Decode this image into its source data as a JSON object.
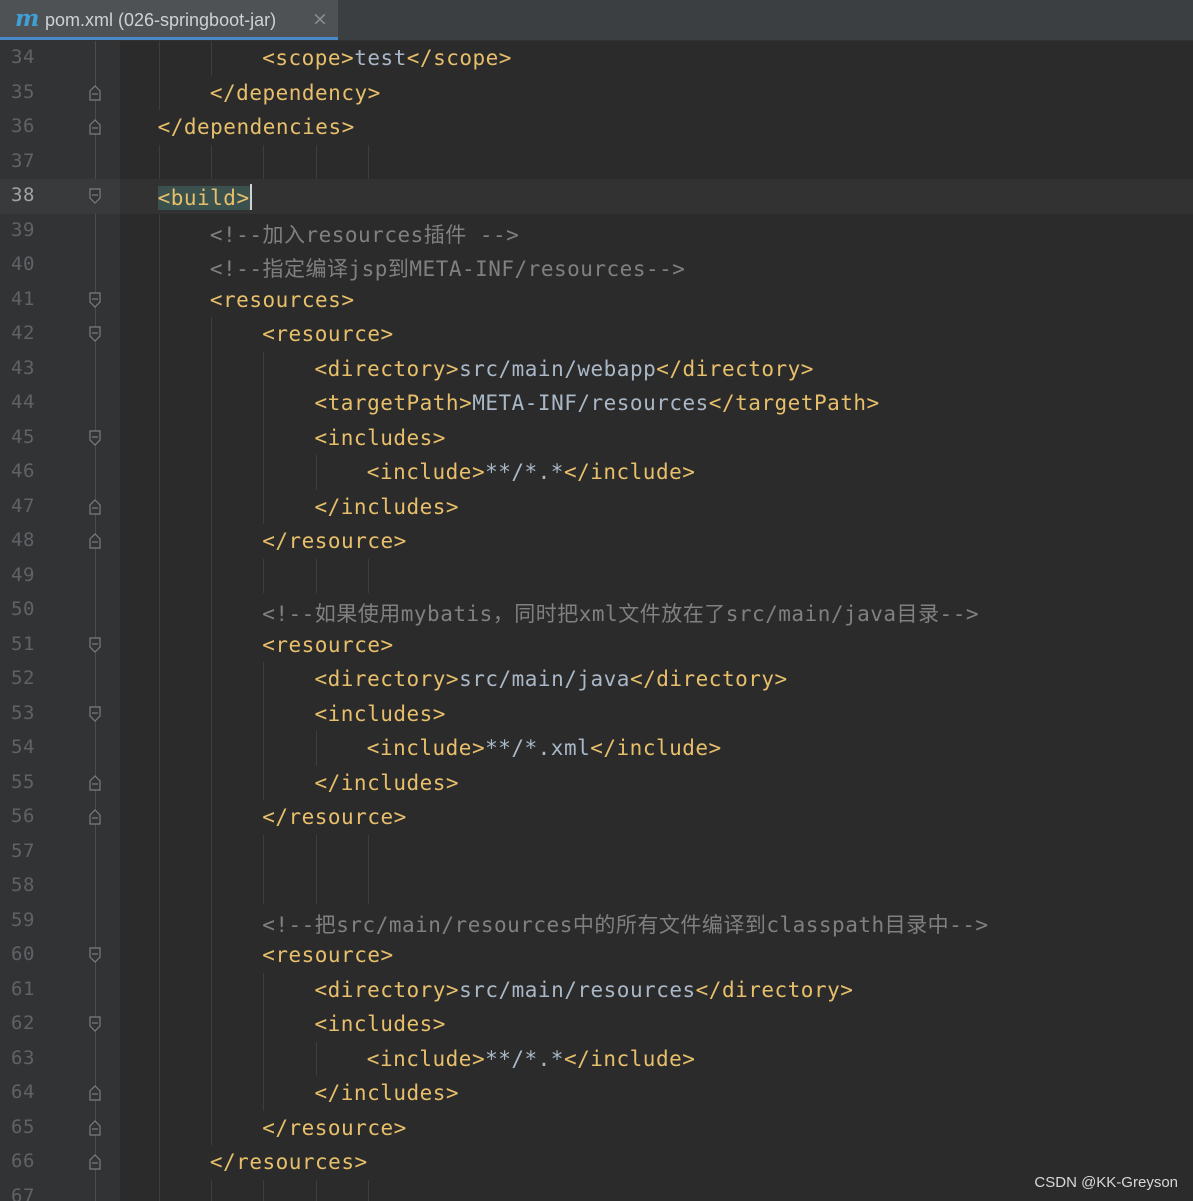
{
  "tab": {
    "icon": "m",
    "icon_name": "maven-icon",
    "title": "pom.xml (026-springboot-jar)",
    "close": "×"
  },
  "watermark": "CSDN @KK-Greyson",
  "colors": {
    "tag": "#e8bf6a",
    "text": "#a9b7c6",
    "comment": "#808080",
    "background": "#2b2b2b",
    "accent": "#4a88c7"
  },
  "current_line": "38",
  "lines": [
    {
      "num": "34",
      "indent": 4,
      "fold": "",
      "segs": [
        {
          "t": "tag",
          "v": "<scope>"
        },
        {
          "t": "txt",
          "v": "test"
        },
        {
          "t": "tag",
          "v": "</scope>"
        }
      ]
    },
    {
      "num": "35",
      "indent": 3,
      "fold": "end",
      "segs": [
        {
          "t": "tag",
          "v": "</dependency>"
        }
      ]
    },
    {
      "num": "36",
      "indent": 2,
      "fold": "end",
      "segs": [
        {
          "t": "tag",
          "v": "</dependencies>"
        }
      ]
    },
    {
      "num": "37",
      "indent": 0,
      "fold": "",
      "segs": []
    },
    {
      "num": "38",
      "indent": 2,
      "fold": "start",
      "segs": [
        {
          "t": "tag hl",
          "v": "<build>"
        }
      ]
    },
    {
      "num": "39",
      "indent": 3,
      "fold": "",
      "segs": [
        {
          "t": "cmt",
          "v": "<!--加入resources插件 -->"
        }
      ]
    },
    {
      "num": "40",
      "indent": 3,
      "fold": "",
      "segs": [
        {
          "t": "cmt",
          "v": "<!--指定编译jsp到META-INF/resources-->"
        }
      ]
    },
    {
      "num": "41",
      "indent": 3,
      "fold": "start",
      "segs": [
        {
          "t": "tag",
          "v": "<resources>"
        }
      ]
    },
    {
      "num": "42",
      "indent": 4,
      "fold": "start",
      "segs": [
        {
          "t": "tag",
          "v": "<resource>"
        }
      ]
    },
    {
      "num": "43",
      "indent": 5,
      "fold": "",
      "segs": [
        {
          "t": "tag",
          "v": "<directory>"
        },
        {
          "t": "txt",
          "v": "src/main/webapp"
        },
        {
          "t": "tag",
          "v": "</directory>"
        }
      ]
    },
    {
      "num": "44",
      "indent": 5,
      "fold": "",
      "segs": [
        {
          "t": "tag",
          "v": "<targetPath>"
        },
        {
          "t": "txt",
          "v": "META-INF/resources"
        },
        {
          "t": "tag",
          "v": "</targetPath>"
        }
      ]
    },
    {
      "num": "45",
      "indent": 5,
      "fold": "start",
      "segs": [
        {
          "t": "tag",
          "v": "<includes>"
        }
      ]
    },
    {
      "num": "46",
      "indent": 6,
      "fold": "",
      "segs": [
        {
          "t": "tag",
          "v": "<include>"
        },
        {
          "t": "txt",
          "v": "**/*.*"
        },
        {
          "t": "tag",
          "v": "</include>"
        }
      ]
    },
    {
      "num": "47",
      "indent": 5,
      "fold": "end",
      "segs": [
        {
          "t": "tag",
          "v": "</includes>"
        }
      ]
    },
    {
      "num": "48",
      "indent": 4,
      "fold": "end",
      "segs": [
        {
          "t": "tag",
          "v": "</resource>"
        }
      ]
    },
    {
      "num": "49",
      "indent": 0,
      "fold": "",
      "segs": []
    },
    {
      "num": "50",
      "indent": 4,
      "fold": "",
      "segs": [
        {
          "t": "cmt",
          "v": "<!--如果使用mybatis，同时把xml文件放在了src/main/java目录-->"
        }
      ]
    },
    {
      "num": "51",
      "indent": 4,
      "fold": "start",
      "segs": [
        {
          "t": "tag",
          "v": "<resource>"
        }
      ]
    },
    {
      "num": "52",
      "indent": 5,
      "fold": "",
      "segs": [
        {
          "t": "tag",
          "v": "<directory>"
        },
        {
          "t": "txt",
          "v": "src/main/java"
        },
        {
          "t": "tag",
          "v": "</directory>"
        }
      ]
    },
    {
      "num": "53",
      "indent": 5,
      "fold": "start",
      "segs": [
        {
          "t": "tag",
          "v": "<includes>"
        }
      ]
    },
    {
      "num": "54",
      "indent": 6,
      "fold": "",
      "segs": [
        {
          "t": "tag",
          "v": "<include>"
        },
        {
          "t": "txt",
          "v": "**/*.xml"
        },
        {
          "t": "tag",
          "v": "</include>"
        }
      ]
    },
    {
      "num": "55",
      "indent": 5,
      "fold": "end",
      "segs": [
        {
          "t": "tag",
          "v": "</includes>"
        }
      ]
    },
    {
      "num": "56",
      "indent": 4,
      "fold": "end",
      "segs": [
        {
          "t": "tag",
          "v": "</resource>"
        }
      ]
    },
    {
      "num": "57",
      "indent": 0,
      "fold": "",
      "segs": []
    },
    {
      "num": "58",
      "indent": 0,
      "fold": "",
      "segs": []
    },
    {
      "num": "59",
      "indent": 4,
      "fold": "",
      "segs": [
        {
          "t": "cmt",
          "v": "<!--把src/main/resources中的所有文件编译到classpath目录中-->"
        }
      ]
    },
    {
      "num": "60",
      "indent": 4,
      "fold": "start",
      "segs": [
        {
          "t": "tag",
          "v": "<resource>"
        }
      ]
    },
    {
      "num": "61",
      "indent": 5,
      "fold": "",
      "segs": [
        {
          "t": "tag",
          "v": "<directory>"
        },
        {
          "t": "txt",
          "v": "src/main/resources"
        },
        {
          "t": "tag",
          "v": "</directory>"
        }
      ]
    },
    {
      "num": "62",
      "indent": 5,
      "fold": "start",
      "segs": [
        {
          "t": "tag",
          "v": "<includes>"
        }
      ]
    },
    {
      "num": "63",
      "indent": 6,
      "fold": "",
      "segs": [
        {
          "t": "tag",
          "v": "<include>"
        },
        {
          "t": "txt",
          "v": "**/*.*"
        },
        {
          "t": "tag",
          "v": "</include>"
        }
      ]
    },
    {
      "num": "64",
      "indent": 5,
      "fold": "end",
      "segs": [
        {
          "t": "tag",
          "v": "</includes>"
        }
      ]
    },
    {
      "num": "65",
      "indent": 4,
      "fold": "end",
      "segs": [
        {
          "t": "tag",
          "v": "</resource>"
        }
      ]
    },
    {
      "num": "66",
      "indent": 3,
      "fold": "end",
      "segs": [
        {
          "t": "tag",
          "v": "</resources>"
        }
      ]
    },
    {
      "num": "67",
      "indent": 0,
      "fold": "",
      "segs": []
    }
  ]
}
